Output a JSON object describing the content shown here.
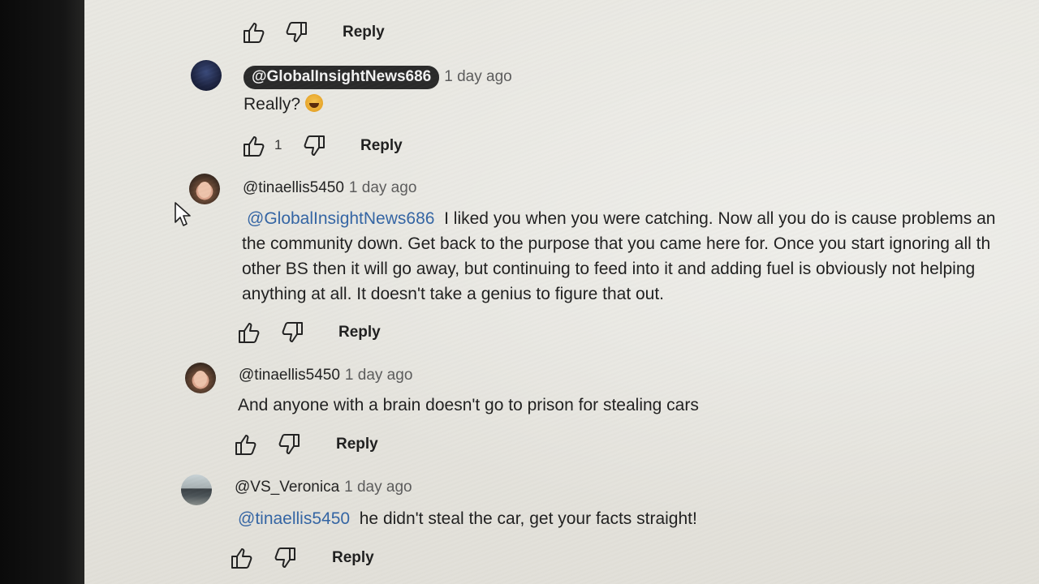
{
  "comments": [
    {
      "handle": "",
      "time": "",
      "text": "",
      "likes": "",
      "reply_label": "Reply"
    },
    {
      "handle": "@GlobalInsightNews686",
      "time": "1 day ago",
      "text": "Really?",
      "likes": "1",
      "reply_label": "Reply",
      "emoji": "laughing-emoji"
    },
    {
      "handle": "@tinaellis5450",
      "time": "1 day ago",
      "mention": "@GlobalInsightNews686",
      "lines": [
        "I liked you when you were catching. Now all you do is cause problems an",
        "the community down. Get back to the purpose that you came here for. Once you start ignoring all th",
        "other BS then it will go away, but continuing to feed into it and adding fuel is obviously not helping",
        "anything at all. It doesn't take a genius to figure that out."
      ],
      "reply_label": "Reply"
    },
    {
      "handle": "@tinaellis5450",
      "time": "1 day ago",
      "text": "And anyone with a brain doesn't go to prison for stealing cars",
      "reply_label": "Reply"
    },
    {
      "handle": "@VS_Veronica",
      "time": "1 day ago",
      "mention": "@tinaellis5450",
      "text": "he didn't steal the car, get your facts straight!",
      "reply_label": "Reply"
    }
  ],
  "icons": {
    "like": "thumbs-up-icon",
    "dislike": "thumbs-down-icon",
    "cursor": "mouse-pointer-icon"
  }
}
